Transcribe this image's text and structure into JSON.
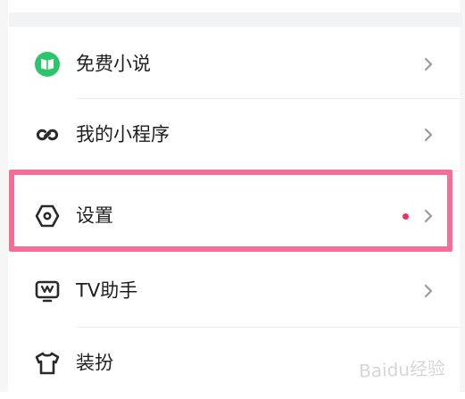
{
  "menu": {
    "items": [
      {
        "label": "免费小说",
        "icon": "book-icon",
        "badge": false
      },
      {
        "label": "我的小程序",
        "icon": "mini-program-icon",
        "badge": false
      },
      {
        "label": "设置",
        "icon": "settings-hexagon-icon",
        "badge": true
      },
      {
        "label": "TV助手",
        "icon": "tv-assistant-icon",
        "badge": false
      },
      {
        "label": "装扮",
        "icon": "tshirt-icon",
        "badge": false
      }
    ]
  },
  "colors": {
    "accent_green": "#2bc66b",
    "highlight_pink": "#f36f98",
    "badge_red": "#f1305b",
    "text": "#1f1f1f",
    "chevron": "#9a9a9a"
  },
  "watermark": {
    "text": "Baidu经验"
  }
}
